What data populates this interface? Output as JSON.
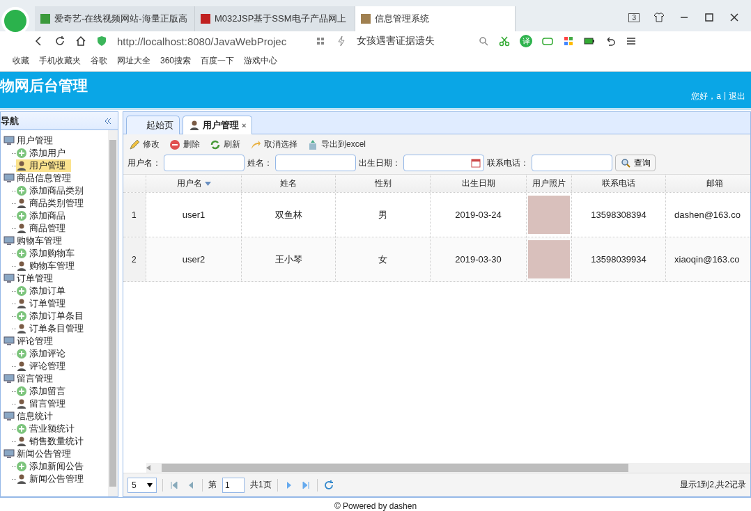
{
  "browser": {
    "tabs": [
      {
        "title": "爱奇艺-在线视频网站-海量正版高",
        "selected": false
      },
      {
        "title": "M032JSP基于SSM电子产品网上",
        "selected": false
      },
      {
        "title": "信息管理系统",
        "selected": true
      }
    ],
    "tab_count": "3",
    "address": "http://localhost:8080/JavaWebProjec",
    "search": "女孩遇害证据遗失",
    "translate": "译",
    "bookmarks": [
      "收藏",
      "手机收藏夹",
      "谷歌",
      "网址大全",
      "360搜索",
      "百度一下",
      "游戏中心"
    ]
  },
  "header": {
    "title": "物网后台管理",
    "greeting": "您好，a",
    "separator": "|",
    "logout": "退出"
  },
  "sidebar": {
    "title": "导航",
    "groups": [
      {
        "label": "用户管理",
        "children": [
          {
            "label": "添加用户",
            "kind": "add",
            "selected": false
          },
          {
            "label": "用户管理",
            "kind": "manage",
            "selected": true
          }
        ]
      },
      {
        "label": "商品信息管理",
        "children": [
          {
            "label": "添加商品类别",
            "kind": "add",
            "selected": false
          },
          {
            "label": "商品类别管理",
            "kind": "manage",
            "selected": false
          },
          {
            "label": "添加商品",
            "kind": "add",
            "selected": false
          },
          {
            "label": "商品管理",
            "kind": "manage",
            "selected": false
          }
        ]
      },
      {
        "label": "购物车管理",
        "children": [
          {
            "label": "添加购物车",
            "kind": "add",
            "selected": false
          },
          {
            "label": "购物车管理",
            "kind": "manage",
            "selected": false
          }
        ]
      },
      {
        "label": "订单管理",
        "children": [
          {
            "label": "添加订单",
            "kind": "add",
            "selected": false
          },
          {
            "label": "订单管理",
            "kind": "manage",
            "selected": false
          },
          {
            "label": "添加订单条目",
            "kind": "add",
            "selected": false
          },
          {
            "label": "订单条目管理",
            "kind": "manage",
            "selected": false
          }
        ]
      },
      {
        "label": "评论管理",
        "children": [
          {
            "label": "添加评论",
            "kind": "add",
            "selected": false
          },
          {
            "label": "评论管理",
            "kind": "manage",
            "selected": false
          }
        ]
      },
      {
        "label": "留言管理",
        "children": [
          {
            "label": "添加留言",
            "kind": "add",
            "selected": false
          },
          {
            "label": "留言管理",
            "kind": "manage",
            "selected": false
          }
        ]
      },
      {
        "label": "信息统计",
        "children": [
          {
            "label": "营业额统计",
            "kind": "add",
            "selected": false
          },
          {
            "label": "销售数量统计",
            "kind": "manage",
            "selected": false
          }
        ]
      },
      {
        "label": "新闻公告管理",
        "children": [
          {
            "label": "添加新闻公告",
            "kind": "add",
            "selected": false
          },
          {
            "label": "新闻公告管理",
            "kind": "manage",
            "selected": false
          }
        ]
      }
    ]
  },
  "tabs": [
    {
      "label": "起始页",
      "selected": false
    },
    {
      "label": "用户管理",
      "selected": true,
      "close": "×"
    }
  ],
  "toolbar": [
    {
      "label": "修改",
      "kind": "edit"
    },
    {
      "label": "删除",
      "kind": "delete"
    },
    {
      "label": "刷新",
      "kind": "refresh"
    },
    {
      "label": "取消选择",
      "kind": "undo"
    },
    {
      "label": "导出到excel",
      "kind": "export"
    }
  ],
  "filters": [
    {
      "label": "用户名：",
      "kind": "text"
    },
    {
      "label": "姓名：",
      "kind": "text"
    },
    {
      "label": "出生日期：",
      "kind": "date"
    },
    {
      "label": "联系电话：",
      "kind": "text"
    }
  ],
  "query_button": "查询",
  "table": {
    "columns": [
      {
        "label": "用户名",
        "sorted": true
      },
      {
        "label": "姓名",
        "sorted": false
      },
      {
        "label": "性别",
        "sorted": false
      },
      {
        "label": "出生日期",
        "sorted": false
      },
      {
        "label": "用户照片",
        "sorted": false
      },
      {
        "label": "联系电话",
        "sorted": false
      },
      {
        "label": "邮箱",
        "sorted": false
      }
    ],
    "rows": [
      {
        "index": "1",
        "cells": [
          "user1",
          "双鱼林",
          "男",
          "2019-03-24",
          null,
          "13598308394",
          "dashen@163.co"
        ]
      },
      {
        "index": "2",
        "cells": [
          "user2",
          "王小琴",
          "女",
          "2019-03-30",
          null,
          "13598039934",
          "xiaoqin@163.co"
        ]
      }
    ]
  },
  "pager": {
    "page_size": "5",
    "page_prefix": "第",
    "page": "1",
    "page_total": "共1页",
    "info": "显示1到2,共2记录"
  },
  "footer": "© Powered by dashen"
}
